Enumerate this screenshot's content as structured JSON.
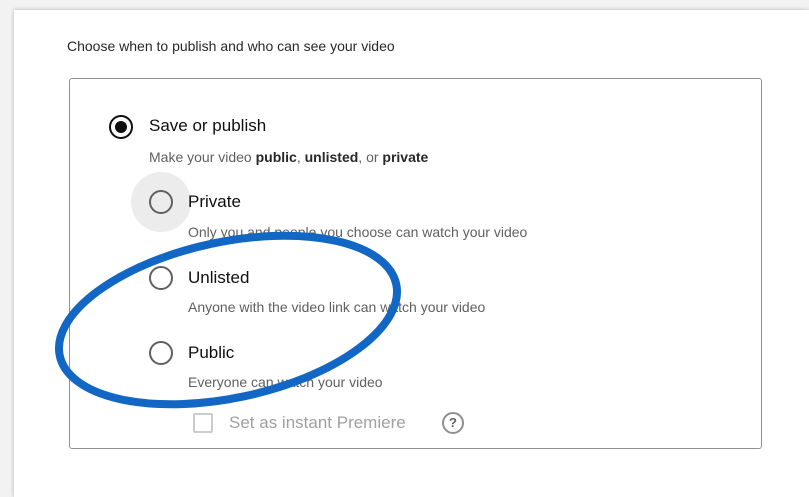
{
  "heading": "Choose when to publish and who can see your video",
  "save_or_publish": {
    "label": "Save or publish",
    "selected": true,
    "desc_prefix": "Make your video ",
    "desc_public": "public",
    "desc_sep1": ", ",
    "desc_unlisted": "unlisted",
    "desc_sep2": ", or ",
    "desc_private": "private"
  },
  "options": [
    {
      "label": "Private",
      "description": "Only you and people you choose can watch your video"
    },
    {
      "label": "Unlisted",
      "description": "Anyone with the video link can watch your video"
    },
    {
      "label": "Public",
      "description": "Everyone can watch your video"
    }
  ],
  "premiere": {
    "label": "Set as instant Premiere",
    "help_glyph": "?",
    "checked": false,
    "disabled": true
  },
  "colors": {
    "annotation_circle": "#1266c4",
    "text_primary": "#0f0f0f",
    "text_secondary": "#606060"
  }
}
